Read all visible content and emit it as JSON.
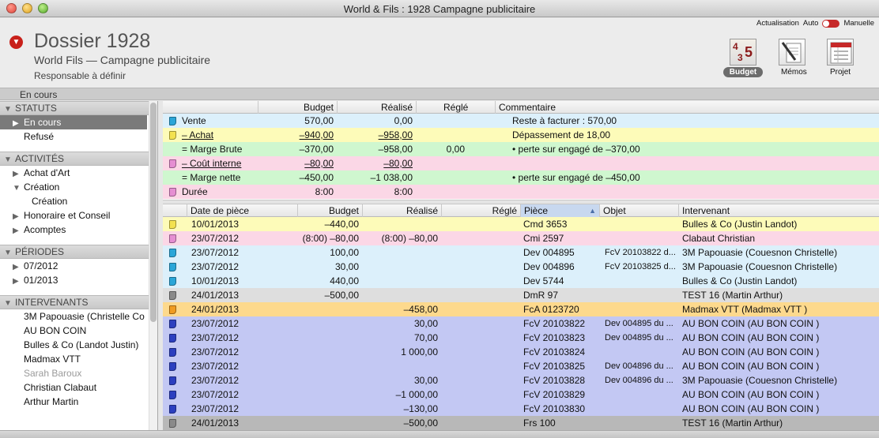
{
  "window": {
    "title": "World & Fils : 1928 Campagne publicitaire"
  },
  "refresh": {
    "label": "Actualisation",
    "auto": "Auto",
    "manual": "Manuelle"
  },
  "dossier": {
    "title": "Dossier 1928",
    "subtitle": "World  Fils — Campagne publicitaire",
    "responsable": "Responsable à définir"
  },
  "toolbar": {
    "budget": "Budget",
    "memos": "Mémos",
    "projet": "Projet",
    "budget_icon_text": [
      "4",
      "3",
      "5"
    ]
  },
  "status_strip": "En cours",
  "sidebar": {
    "statuts_title": "STATUTS",
    "statuts": [
      {
        "label": "En cours",
        "selected": true,
        "arrow": "▶"
      },
      {
        "label": "Refusé"
      }
    ],
    "activites_title": "ACTIVITÉS",
    "activites": [
      {
        "label": "Achat d'Art",
        "arrow": "▶"
      },
      {
        "label": "Création",
        "arrow": "▼"
      },
      {
        "label": "Création",
        "child": true
      },
      {
        "label": "Honoraire et Conseil",
        "arrow": "▶"
      },
      {
        "label": "Acomptes",
        "arrow": "▶"
      }
    ],
    "periodes_title": "PÉRIODES",
    "periodes": [
      {
        "label": "07/2012",
        "arrow": "▶"
      },
      {
        "label": "01/2013",
        "arrow": "▶"
      }
    ],
    "intervenants_title": "INTERVENANTS",
    "intervenants": [
      {
        "label": "3M Papouasie (Christelle Co"
      },
      {
        "label": "AU BON COIN"
      },
      {
        "label": "Bulles & Co (Landot Justin)"
      },
      {
        "label": "Madmax VTT"
      },
      {
        "label": "Sarah Baroux",
        "muted": true
      },
      {
        "label": "Christian Clabaut"
      },
      {
        "label": "Arthur Martin"
      }
    ]
  },
  "summary": {
    "columns": [
      "Budget",
      "Réalisé",
      "Réglé",
      "Commentaire"
    ],
    "rows": [
      {
        "label": "Vente",
        "budget": "570,00",
        "realise": "0,00",
        "regle": "",
        "comment": "Reste à facturer : 570,00",
        "color": "blue",
        "tag": "blue",
        "underline": false
      },
      {
        "label": "– Achat",
        "budget": "–940,00",
        "realise": "–958,00",
        "regle": "",
        "comment": "Dépassement de 18,00",
        "color": "yellow",
        "tag": "yellow",
        "underline": true
      },
      {
        "label": "= Marge Brute",
        "budget": "–370,00",
        "realise": "–958,00",
        "regle": "0,00",
        "comment": "• perte sur engagé de –370,00",
        "color": "green",
        "tag": "",
        "underline": false
      },
      {
        "label": "– Coût interne",
        "budget": "–80,00",
        "realise": "–80,00",
        "regle": "",
        "comment": "",
        "color": "pink",
        "tag": "pink",
        "underline": true
      },
      {
        "label": "= Marge nette",
        "budget": "–450,00",
        "realise": "–1 038,00",
        "regle": "",
        "comment": "• perte sur engagé de –450,00",
        "color": "green",
        "tag": "",
        "underline": false
      },
      {
        "label": "Durée",
        "budget": "8:00",
        "realise": "8:00",
        "regle": "",
        "comment": "",
        "color": "pink",
        "tag": "pink",
        "underline": false
      }
    ]
  },
  "detail": {
    "columns": [
      "Date de pièce",
      "Budget",
      "Réalisé",
      "Réglé",
      "Pièce",
      "Objet",
      "Intervenant"
    ],
    "sorted_column": "Pièce",
    "rows": [
      {
        "date": "10/01/2013",
        "budget": "–440,00",
        "realise": "",
        "regle": "",
        "piece": "Cmd 3653",
        "objet": "",
        "intervenant": "Bulles & Co (Justin Landot)",
        "color": "yellow",
        "tag": "yellow"
      },
      {
        "date": "23/07/2012",
        "budget": "(8:00) –80,00",
        "realise": "(8:00) –80,00",
        "regle": "",
        "piece": "Cmi 2597",
        "objet": "",
        "intervenant": "Clabaut Christian",
        "color": "pink",
        "tag": "pink"
      },
      {
        "date": "23/07/2012",
        "budget": "100,00",
        "realise": "",
        "regle": "",
        "piece": "Dev 004895",
        "objet": "FcV 20103822 d...",
        "intervenant": "3M Papouasie (Couesnon Christelle)",
        "color": "blue",
        "tag": "blue"
      },
      {
        "date": "23/07/2012",
        "budget": "30,00",
        "realise": "",
        "regle": "",
        "piece": "Dev 004896",
        "objet": "FcV 20103825 d...",
        "intervenant": "3M Papouasie (Couesnon Christelle)",
        "color": "blue",
        "tag": "blue"
      },
      {
        "date": "10/01/2013",
        "budget": "440,00",
        "realise": "",
        "regle": "",
        "piece": "Dev 5744",
        "objet": "",
        "intervenant": "Bulles & Co (Justin Landot)",
        "color": "blue",
        "tag": "blue"
      },
      {
        "date": "24/01/2013",
        "budget": "–500,00",
        "realise": "",
        "regle": "",
        "piece": "DmR 97",
        "objet": "",
        "intervenant": "TEST 16 (Martin Arthur)",
        "color": "grey",
        "tag": "grey"
      },
      {
        "date": "24/01/2013",
        "budget": "",
        "realise": "–458,00",
        "regle": "",
        "piece": "FcA 0123720",
        "objet": "",
        "intervenant": "Madmax VTT (Madmax VTT )",
        "color": "orange",
        "tag": "orange"
      },
      {
        "date": "23/07/2012",
        "budget": "",
        "realise": "30,00",
        "regle": "",
        "piece": "FcV 20103822",
        "objet": "Dev 004895 du ...",
        "intervenant": "AU BON COIN (AU BON COIN )",
        "color": "purple",
        "tag": "navy"
      },
      {
        "date": "23/07/2012",
        "budget": "",
        "realise": "70,00",
        "regle": "",
        "piece": "FcV 20103823",
        "objet": "Dev 004895 du ...",
        "intervenant": "AU BON COIN (AU BON COIN )",
        "color": "purple",
        "tag": "navy"
      },
      {
        "date": "23/07/2012",
        "budget": "",
        "realise": "1 000,00",
        "regle": "",
        "piece": "FcV 20103824",
        "objet": "",
        "intervenant": "AU BON COIN (AU BON COIN )",
        "color": "purple",
        "tag": "navy"
      },
      {
        "date": "23/07/2012",
        "budget": "",
        "realise": "",
        "regle": "",
        "piece": "FcV 20103825",
        "objet": "Dev 004896 du ...",
        "intervenant": "AU BON COIN (AU BON COIN )",
        "color": "purple",
        "tag": "navy"
      },
      {
        "date": "23/07/2012",
        "budget": "",
        "realise": "30,00",
        "regle": "",
        "piece": "FcV 20103828",
        "objet": "Dev 004896 du ...",
        "intervenant": "3M Papouasie (Couesnon Christelle)",
        "color": "purple",
        "tag": "navy"
      },
      {
        "date": "23/07/2012",
        "budget": "",
        "realise": "–1 000,00",
        "regle": "",
        "piece": "FcV 20103829",
        "objet": "",
        "intervenant": "AU BON COIN (AU BON COIN )",
        "color": "purple",
        "tag": "navy"
      },
      {
        "date": "23/07/2012",
        "budget": "",
        "realise": "–130,00",
        "regle": "",
        "piece": "FcV 20103830",
        "objet": "",
        "intervenant": "AU BON COIN (AU BON COIN )",
        "color": "purple",
        "tag": "navy"
      },
      {
        "date": "24/01/2013",
        "budget": "",
        "realise": "–500,00",
        "regle": "",
        "piece": "Frs 100",
        "objet": "",
        "intervenant": "TEST 16 (Martin Arthur)",
        "color": "dgrey",
        "tag": "grey"
      }
    ]
  }
}
